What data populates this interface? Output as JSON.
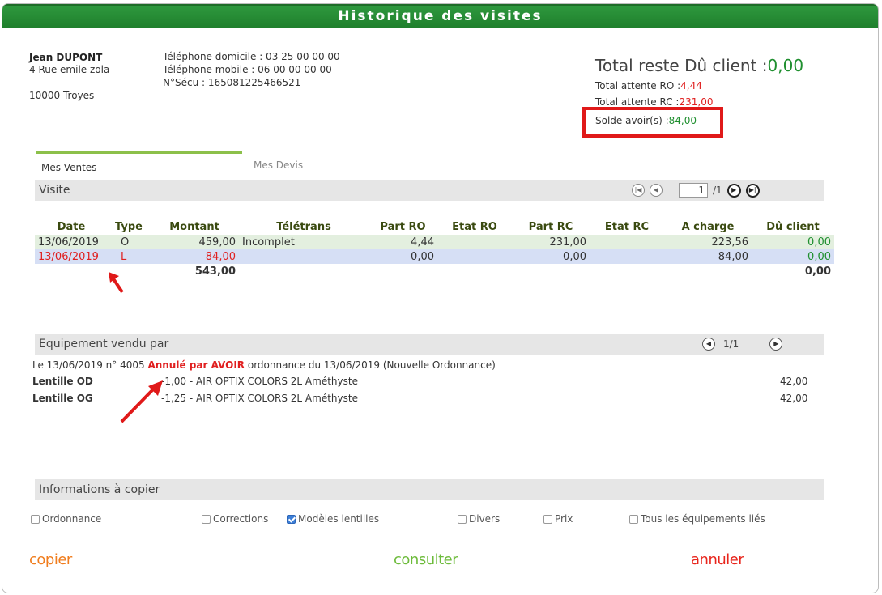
{
  "window": {
    "title": "Historique des visites"
  },
  "client": {
    "name": "Jean DUPONT",
    "address1": "4 Rue emile zola",
    "city": "10000 Troyes",
    "phone_home": "Téléphone domicile : 03 25 00 00 00",
    "phone_mobile": "Téléphone mobile : 06 00 00 00 00",
    "secu": "N°Sécu : 165081225466521"
  },
  "totals": {
    "total_label": "Total reste Dû client :",
    "total_value": "0,00",
    "ro_label": "Total attente RO :",
    "ro_value": "4,44",
    "rc_label": "Total attente RC :",
    "rc_value": "231,00",
    "avoir_label": "Solde avoir(s) :",
    "avoir_value": "84,00"
  },
  "tabs": [
    {
      "label": "Mes Ventes",
      "active": true
    },
    {
      "label": "Mes Devis",
      "active": false
    }
  ],
  "visite": {
    "section_title": "Visite",
    "page_current": "1",
    "page_total": "/1",
    "columns": [
      "Date",
      "Type",
      "Montant",
      "Télétrans",
      "Part RO",
      "Etat RO",
      "Part RC",
      "Etat RC",
      "A charge",
      "Dû client"
    ],
    "rows": [
      {
        "date": "13/06/2019",
        "type": "O",
        "montant": "459,00",
        "teletrans": "Incomplet",
        "part_ro": "4,44",
        "etat_ro": "",
        "part_rc": "231,00",
        "etat_rc": "",
        "a_charge": "223,56",
        "du_client": "0,00"
      },
      {
        "date": "13/06/2019",
        "type": "L",
        "montant": "84,00",
        "teletrans": "",
        "part_ro": "0,00",
        "etat_ro": "",
        "part_rc": "0,00",
        "etat_rc": "",
        "a_charge": "84,00",
        "du_client": "0,00"
      }
    ],
    "total_montant": "543,00",
    "total_du": "0,00"
  },
  "equipement": {
    "section_title": "Equipement vendu par",
    "pager": "1/1",
    "info_prefix": "Le 13/06/2019 n° 4005",
    "info_status": "Annulé par AVOIR",
    "info_suffix": "ordonnance du 13/06/2019 (Nouvelle Ordonnance)",
    "items": [
      {
        "label": "Lentille OD",
        "desc": "-1,00 - AIR OPTIX COLORS 2L Améthyste",
        "price": "42,00"
      },
      {
        "label": "Lentille OG",
        "desc": "-1,25 - AIR OPTIX COLORS 2L Améthyste",
        "price": "42,00"
      }
    ]
  },
  "copy_info": {
    "section_title": "Informations à copier",
    "options": [
      {
        "label": "Ordonnance",
        "checked": false
      },
      {
        "label": "Corrections",
        "checked": false
      },
      {
        "label": "Modèles lentilles",
        "checked": true
      },
      {
        "label": "Divers",
        "checked": false
      },
      {
        "label": "Prix",
        "checked": false
      },
      {
        "label": "Tous les équipements liés",
        "checked": false
      }
    ]
  },
  "actions": {
    "copier": "copier",
    "consulter": "consulter",
    "annuler": "annuler"
  },
  "colors": {
    "title_bar": "#1f7f2c",
    "accent_green": "#1f8f2f",
    "alert_red": "#e02020",
    "action_orange": "#f07d1e",
    "action_green": "#6dbb3b"
  }
}
